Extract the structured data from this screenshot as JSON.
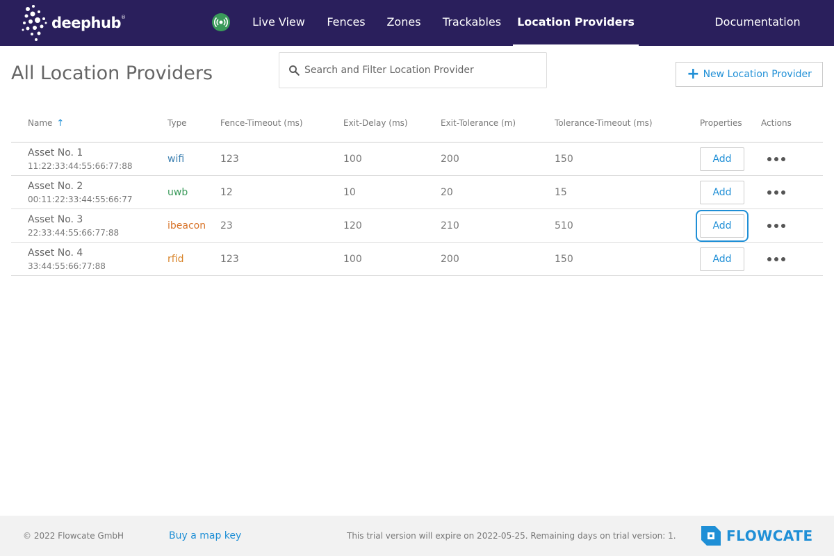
{
  "header": {
    "logo_text": "deephub",
    "logo_mark": "®",
    "status_icon": "broadcast-icon",
    "nav": [
      {
        "label": "Live View",
        "active": false
      },
      {
        "label": "Fences",
        "active": false
      },
      {
        "label": "Zones",
        "active": false
      },
      {
        "label": "Trackables",
        "active": false
      },
      {
        "label": "Location Providers",
        "active": true
      },
      {
        "label": "Documentation",
        "active": false
      }
    ]
  },
  "page": {
    "title": "All Location Providers",
    "search_placeholder": "Search and Filter Location Provider",
    "new_button_label": "New Location Provider"
  },
  "table": {
    "columns": [
      "Name",
      "Type",
      "Fence-Timeout (ms)",
      "Exit-Delay (ms)",
      "Exit-Tolerance (m)",
      "Tolerance-Timeout (ms)",
      "Properties",
      "Actions"
    ],
    "sort_column": "Name",
    "sort_direction": "ascending",
    "add_label": "Add",
    "rows": [
      {
        "name": "Asset No. 1",
        "id": "11:22:33:44:55:66:77:88",
        "type": "wifi",
        "fence_timeout": "123",
        "exit_delay": "100",
        "exit_tolerance": "200",
        "tolerance_timeout": "150"
      },
      {
        "name": "Asset No. 2",
        "id": "00:11:22:33:44:55:66:77",
        "type": "uwb",
        "fence_timeout": "12",
        "exit_delay": "10",
        "exit_tolerance": "20",
        "tolerance_timeout": "15"
      },
      {
        "name": "Asset No. 3",
        "id": "22:33:44:55:66:77:88",
        "type": "ibeacon",
        "fence_timeout": "23",
        "exit_delay": "120",
        "exit_tolerance": "210",
        "tolerance_timeout": "510"
      },
      {
        "name": "Asset No. 4",
        "id": "33:44:55:66:77:88",
        "type": "rfid",
        "fence_timeout": "123",
        "exit_delay": "100",
        "exit_tolerance": "200",
        "tolerance_timeout": "150"
      }
    ]
  },
  "footer": {
    "copyright": "© 2022 Flowcate GmbH",
    "map_key_link": "Buy a map key",
    "trial_notice": "This trial version will expire on 2022-05-25. Remaining days on trial version: 1.",
    "brand": "FLOWCATE"
  },
  "colors": {
    "header_bg": "#2a1f5c",
    "accent": "#1f8fd6",
    "wifi": "#3b7fb0",
    "uwb": "#3a9a5a",
    "ibeacon": "#d8742a",
    "rfid": "#d8842a"
  }
}
